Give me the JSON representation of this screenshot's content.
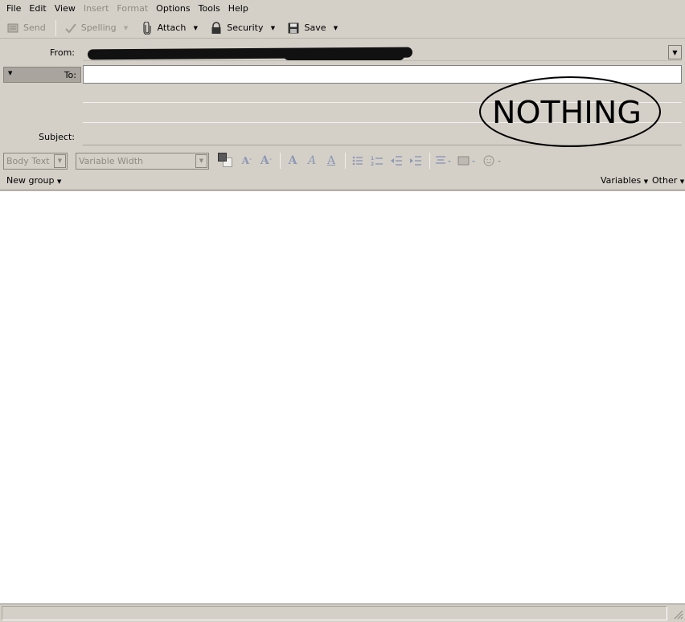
{
  "menubar": {
    "items": [
      {
        "label": "File",
        "disabled": false
      },
      {
        "label": "Edit",
        "disabled": false
      },
      {
        "label": "View",
        "disabled": false
      },
      {
        "label": "Insert",
        "disabled": true
      },
      {
        "label": "Format",
        "disabled": true
      },
      {
        "label": "Options",
        "disabled": false
      },
      {
        "label": "Tools",
        "disabled": false
      },
      {
        "label": "Help",
        "disabled": false
      }
    ]
  },
  "toolbar": {
    "send_label": "Send",
    "spelling_label": "Spelling",
    "attach_label": "Attach",
    "security_label": "Security",
    "save_label": "Save"
  },
  "header": {
    "from_label": "From:",
    "to_type_label": "To:",
    "to_value": "",
    "subject_label": "Subject:",
    "subject_value": "",
    "annotation_text": "NOTHING"
  },
  "format_bar": {
    "paragraph_style": "Body Text",
    "font_name": "Variable Width"
  },
  "group_bar": {
    "new_group_label": "New group",
    "variables_label": "Variables",
    "other_label": "Other"
  },
  "colors": {
    "chrome": "#d4d0c8",
    "disabled_text": "#8e8a82",
    "format_icon": "#8e98b4",
    "body_bg": "#ffffff"
  }
}
